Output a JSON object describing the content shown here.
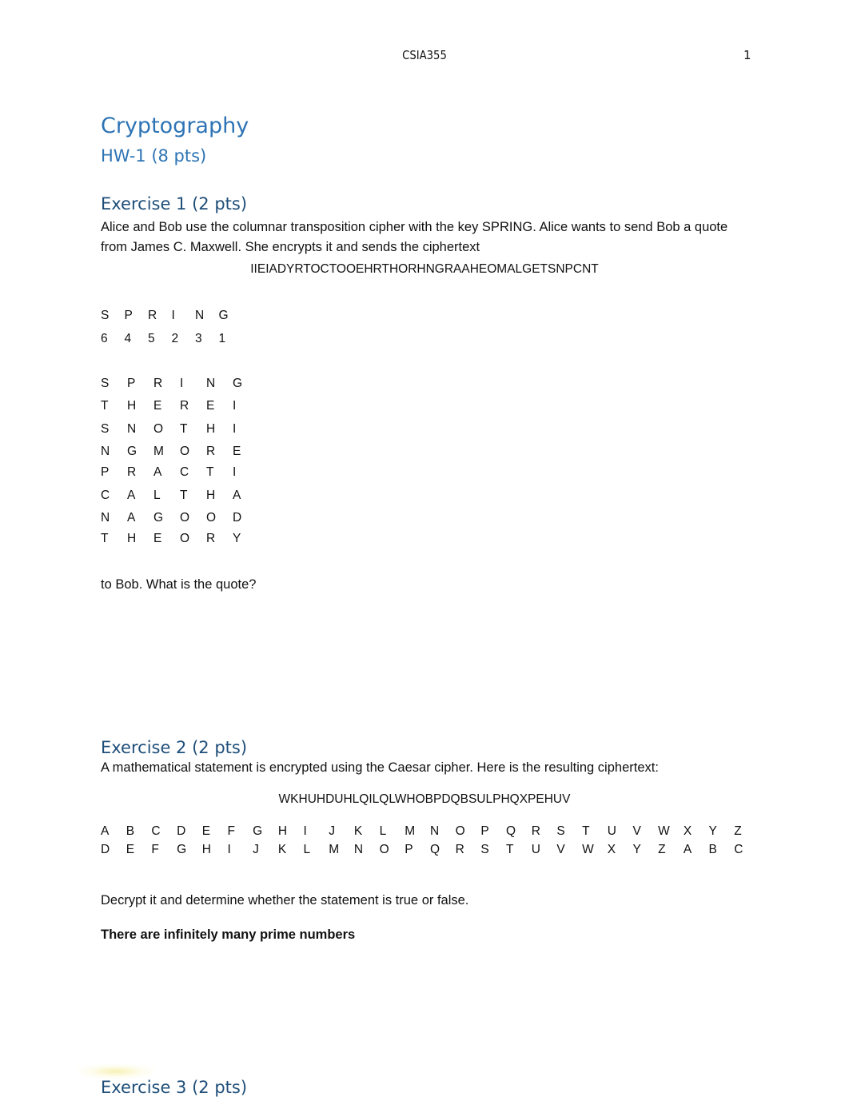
{
  "header": {
    "course_code": "CSIA355",
    "page_number": "1"
  },
  "document": {
    "title": "Cryptography",
    "subtitle": "HW-1 (8 pts)"
  },
  "exercise1": {
    "heading": "Exercise 1 (2 pts)",
    "intro": "Alice and Bob use the columnar transposition cipher with the key SPRING. Alice wants to send Bob a quote from James C. Maxwell. She encrypts it and sends the ciphertext",
    "ciphertext": "IIEIADYRTOCTOOEHRTHORHNGRAAHEOMALGETSNPCNT",
    "key_letters": [
      "S",
      "P",
      "R",
      "I",
      "N",
      "G"
    ],
    "key_order": [
      "6",
      "4",
      "5",
      "2",
      "3",
      "1"
    ],
    "grid_header": [
      "S",
      "P",
      "R",
      "I",
      "N",
      "G"
    ],
    "grid_rows": [
      [
        "T",
        "H",
        "E",
        "R",
        "E",
        "I"
      ],
      [
        "S",
        "N",
        "O",
        "T",
        "H",
        "I"
      ],
      [
        "N",
        "G",
        "M",
        "O",
        "R",
        "E"
      ],
      [
        "P",
        "R",
        "A",
        "C",
        "T",
        "I"
      ],
      [
        "C",
        "A",
        "L",
        "T",
        "H",
        "A"
      ],
      [
        "N",
        "A",
        "G",
        "O",
        "O",
        "D"
      ],
      [
        "T",
        "H",
        "E",
        "O",
        "R",
        "Y"
      ]
    ],
    "question": "to Bob. What is the quote?"
  },
  "exercise2": {
    "heading": "Exercise 2 (2 pts)",
    "intro": "A mathematical statement is encrypted using the Caesar cipher. Here is the resulting ciphertext:",
    "ciphertext": "WKHUHDUHLQILQLWHOBPDQBSULPHQXPEHUV",
    "plain_alphabet": [
      "A",
      "B",
      "C",
      "D",
      "E",
      "F",
      "G",
      "H",
      "I",
      "J",
      "K",
      "L",
      "M",
      "N",
      "O",
      "P",
      "Q",
      "R",
      "S",
      "T",
      "U",
      "V",
      "W",
      "X",
      "Y",
      "Z"
    ],
    "cipher_alphabet": [
      "D",
      "E",
      "F",
      "G",
      "H",
      "I",
      "J",
      "K",
      "L",
      "M",
      "N",
      "O",
      "P",
      "Q",
      "R",
      "S",
      "T",
      "U",
      "V",
      "W",
      "X",
      "Y",
      "Z",
      "A",
      "B",
      "C"
    ],
    "question": "Decrypt it and determine whether the statement is true or false.",
    "answer": "There are infinitely many prime numbers"
  },
  "exercise3": {
    "heading": "Exercise 3 (2 pts)"
  }
}
